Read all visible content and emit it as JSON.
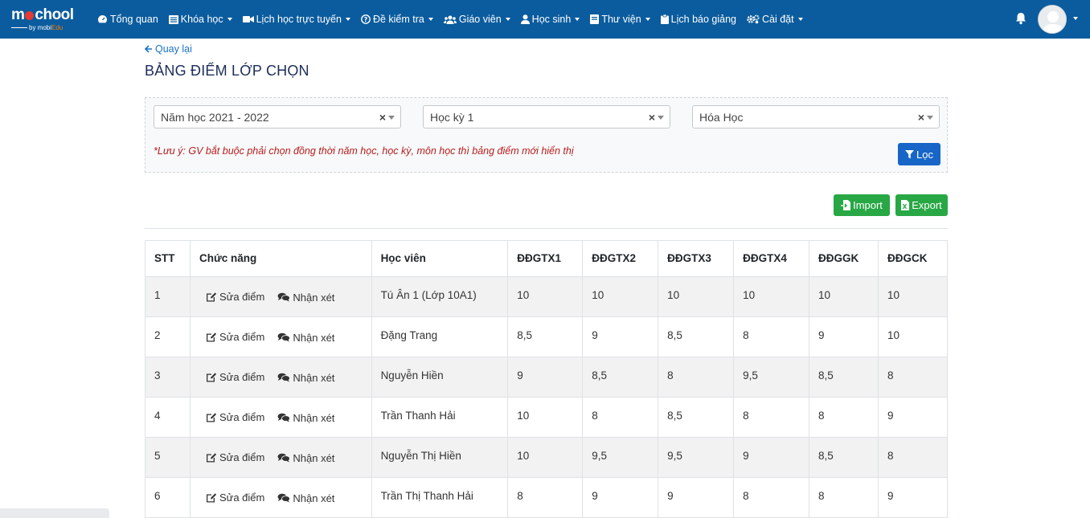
{
  "header": {
    "logo_main": "mSchool",
    "logo_sub_prefix": "by mobi",
    "logo_sub_brand": "Edu",
    "menu": [
      {
        "label": "Tổng quan",
        "icon": "dashboard-icon",
        "caret": false
      },
      {
        "label": "Khóa học",
        "icon": "list-icon",
        "caret": true
      },
      {
        "label": "Lịch học trực tuyến",
        "icon": "video-camera-icon",
        "caret": true
      },
      {
        "label": "Đề kiểm tra",
        "icon": "question-circle-icon",
        "caret": true
      },
      {
        "label": "Giáo viên",
        "icon": "users-icon",
        "caret": true
      },
      {
        "label": "Học sinh",
        "icon": "user-icon",
        "caret": true
      },
      {
        "label": "Thư viện",
        "icon": "book-icon",
        "caret": true
      },
      {
        "label": "Lịch báo giảng",
        "icon": "clipboard-icon",
        "caret": false
      },
      {
        "label": "Cài đặt",
        "icon": "gears-icon",
        "caret": true
      }
    ]
  },
  "back_label": "Quay lại",
  "page_title": "BẢNG ĐIỂM LỚP CHỌN",
  "filters": {
    "year": "Năm học 2021 - 2022",
    "semester": "Học kỳ 1",
    "subject": "Hóa Học",
    "clear_symbol": "×",
    "note": "*Lưu ý: GV bắt buộc phải chọn đồng thời năm học, học kỳ, môn học thì bảng điểm mới hiển thị",
    "filter_label": "Lọc"
  },
  "actions": {
    "import_label": "Import",
    "export_label": "Export"
  },
  "table": {
    "headers": [
      "STT",
      "Chức năng",
      "Học viên",
      "ĐĐGTX1",
      "ĐĐGTX2",
      "ĐĐGTX3",
      "ĐĐGTX4",
      "ĐĐGGK",
      "ĐĐGCK"
    ],
    "edit_label": "Sửa điểm",
    "comment_label": "Nhận xét",
    "rows": [
      {
        "stt": "1",
        "student": "Tú Ân 1 (Lớp 10A1)",
        "scores": [
          "10",
          "10",
          "10",
          "10",
          "10",
          "10"
        ]
      },
      {
        "stt": "2",
        "student": "Đặng Trang",
        "scores": [
          "8,5",
          "9",
          "8,5",
          "8",
          "9",
          "10"
        ]
      },
      {
        "stt": "3",
        "student": "Nguyễn Hiền",
        "scores": [
          "9",
          "8,5",
          "8",
          "9,5",
          "8,5",
          "8"
        ]
      },
      {
        "stt": "4",
        "student": "Trần Thanh Hải",
        "scores": [
          "10",
          "8",
          "8,5",
          "8",
          "8",
          "9"
        ]
      },
      {
        "stt": "5",
        "student": "Nguyễn Thị Hiền",
        "scores": [
          "10",
          "9,5",
          "9,5",
          "9",
          "8,5",
          "8"
        ]
      },
      {
        "stt": "6",
        "student": "Trần Thị Thanh Hải",
        "scores": [
          "8",
          "9",
          "9",
          "8",
          "8",
          "9"
        ]
      }
    ]
  },
  "colors": {
    "nav_bg": "#0b5c9e",
    "primary": "#1766c7",
    "success": "#28a745",
    "warning_text": "#b71c1c"
  }
}
